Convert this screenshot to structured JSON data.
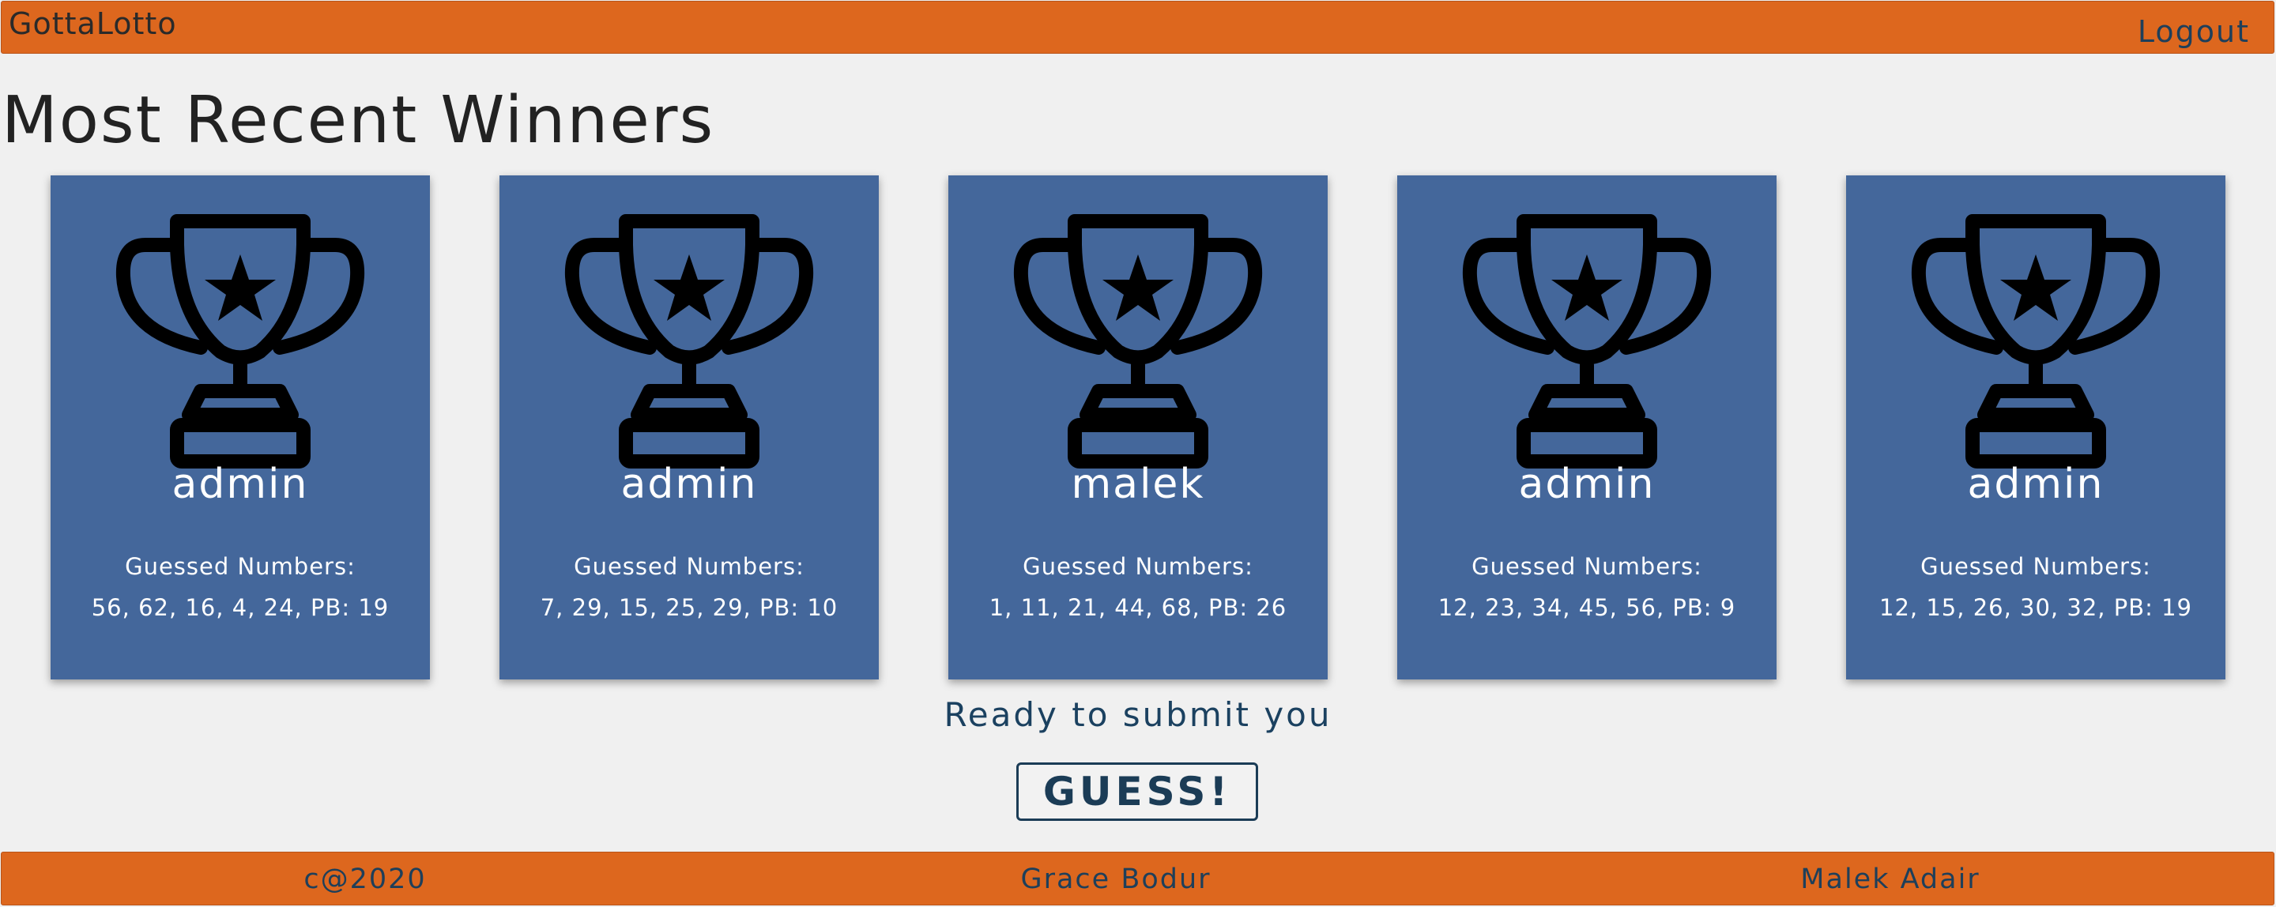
{
  "header": {
    "brand": "GottaLotto",
    "logout_label": "Logout"
  },
  "main": {
    "title": "Most Recent Winners",
    "guess_label": "Guessed Numbers:",
    "winners": [
      {
        "name": "admin",
        "numbers": "56, 62, 16, 4, 24, PB: 19"
      },
      {
        "name": "admin",
        "numbers": "7, 29, 15, 25, 29, PB: 10"
      },
      {
        "name": "malek",
        "numbers": "1, 11, 21, 44, 68, PB: 26"
      },
      {
        "name": "admin",
        "numbers": "12, 23, 34, 45, 56, PB: 9"
      },
      {
        "name": "admin",
        "numbers": "12, 15, 26, 30, 32, PB: 19"
      }
    ],
    "ready_text": "Ready to submit you",
    "guess_button_label": "GUESS!"
  },
  "footer": {
    "copyright": "c@2020",
    "author_1": "Grace Bodur",
    "author_2": "Malek Adair"
  },
  "colors": {
    "bar": "#dd671e",
    "card": "#44679b",
    "accent": "#1b3c56"
  },
  "icons": {
    "card_icon": "trophy-icon"
  }
}
